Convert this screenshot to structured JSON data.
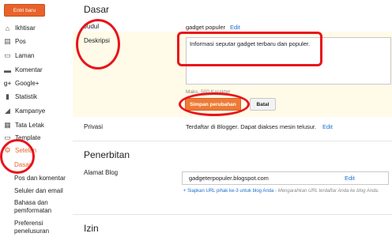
{
  "sidebar": {
    "new_entry_label": "Entri baru",
    "items": [
      {
        "label": "Ikhtisar",
        "icon": "home-icon"
      },
      {
        "label": "Pos",
        "icon": "posts-icon"
      },
      {
        "label": "Laman",
        "icon": "pages-icon"
      },
      {
        "label": "Komentar",
        "icon": "comment-icon"
      },
      {
        "label": "Google+",
        "icon": "google-plus-icon"
      },
      {
        "label": "Statistik",
        "icon": "stats-icon"
      },
      {
        "label": "Kampanye",
        "icon": "campaign-icon"
      },
      {
        "label": "Tata Letak",
        "icon": "layout-icon"
      },
      {
        "label": "Template",
        "icon": "template-icon"
      },
      {
        "label": "Setelan",
        "icon": "settings-icon"
      }
    ],
    "sub_items": [
      "Dasar",
      "Pos dan komentar",
      "Seluler dan email",
      "Bahasa dan pemformatan",
      "Preferensi penelusuran"
    ]
  },
  "basic": {
    "title": "Dasar",
    "judul_label": "Judul",
    "judul_value": "gadget populer",
    "judul_edit": "Edit",
    "deskripsi_label": "Deskripsi",
    "deskripsi_value": "Informasi seputar gadget terbaru dan populer.",
    "max_chars": "Maks. 500 Karakter",
    "save_label": "Simpan perubahan",
    "cancel_label": "Batal",
    "privasi_label": "Privasi",
    "privasi_value": "Terdaftar di Blogger. Dapat diakses mesin telusur.",
    "privasi_edit": "Edit"
  },
  "publishing": {
    "title": "Penerbitan",
    "address_label": "Alamat Blog",
    "address_value": "gadgeterpopuler.blogspot.com",
    "address_edit": "Edit",
    "third_party_link": "+ Siapkan URL pihak ke-3 untuk blog Anda",
    "third_party_note": " - Mengarahkan URL terdaftar Anda ke blog Anda."
  },
  "permissions": {
    "title": "Izin"
  },
  "colors": {
    "accent": "#e8632b",
    "annotation": "#e8141b",
    "link": "#1a6fd1"
  }
}
